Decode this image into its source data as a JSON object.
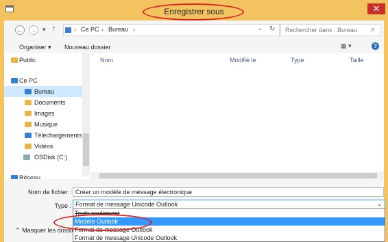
{
  "window": {
    "title": "Enregistrer sous",
    "close_glyph": "✕"
  },
  "address": {
    "back": "←",
    "forward": "→",
    "recent": "▾",
    "up": "↑",
    "path": [
      "Ce PC",
      "Bureau"
    ],
    "chevron": "›",
    "dropdown": "⌄",
    "refresh": "↻",
    "search_placeholder": "Rechercher dans : Bureau",
    "search_glyph": "⌕"
  },
  "toolbar": {
    "organise": "Organiser ▾",
    "new_folder": "Nouveau dossier",
    "view": "▦ ▾",
    "help": "?"
  },
  "nav": {
    "items": [
      {
        "label": "Public",
        "selected": false
      },
      {
        "label": "Ce PC",
        "selected": false
      },
      {
        "label": "Bureau",
        "selected": true
      },
      {
        "label": "Documents",
        "selected": false
      },
      {
        "label": "Images",
        "selected": false
      },
      {
        "label": "Musique",
        "selected": false
      },
      {
        "label": "Téléchargements",
        "selected": false
      },
      {
        "label": "Vidéos",
        "selected": false
      },
      {
        "label": "OSDisk (C:)",
        "selected": false
      },
      {
        "label": "Réseau",
        "selected": false
      }
    ]
  },
  "columns": {
    "name": "Nom",
    "modified": "Modifié le",
    "type": "Type",
    "size": "Taille"
  },
  "form": {
    "filename_label": "Nom de fichier :",
    "filename_value": "Créer un modèle de message électronique",
    "type_label": "Type :",
    "type_value": "Format de message Unicode Outlook",
    "hide_folders": "Masquer les dossie",
    "options": [
      {
        "label": "Texte seulement",
        "selected": false
      },
      {
        "label": "Modèle Outlook",
        "selected": true
      },
      {
        "label": "Format de message Outlook",
        "selected": false
      },
      {
        "label": "Format de message Unicode Outlook",
        "selected": false
      }
    ]
  },
  "colors": {
    "titlebar": "#f2c35f",
    "selection": "#3399ff",
    "annotation": "#dd2222"
  }
}
